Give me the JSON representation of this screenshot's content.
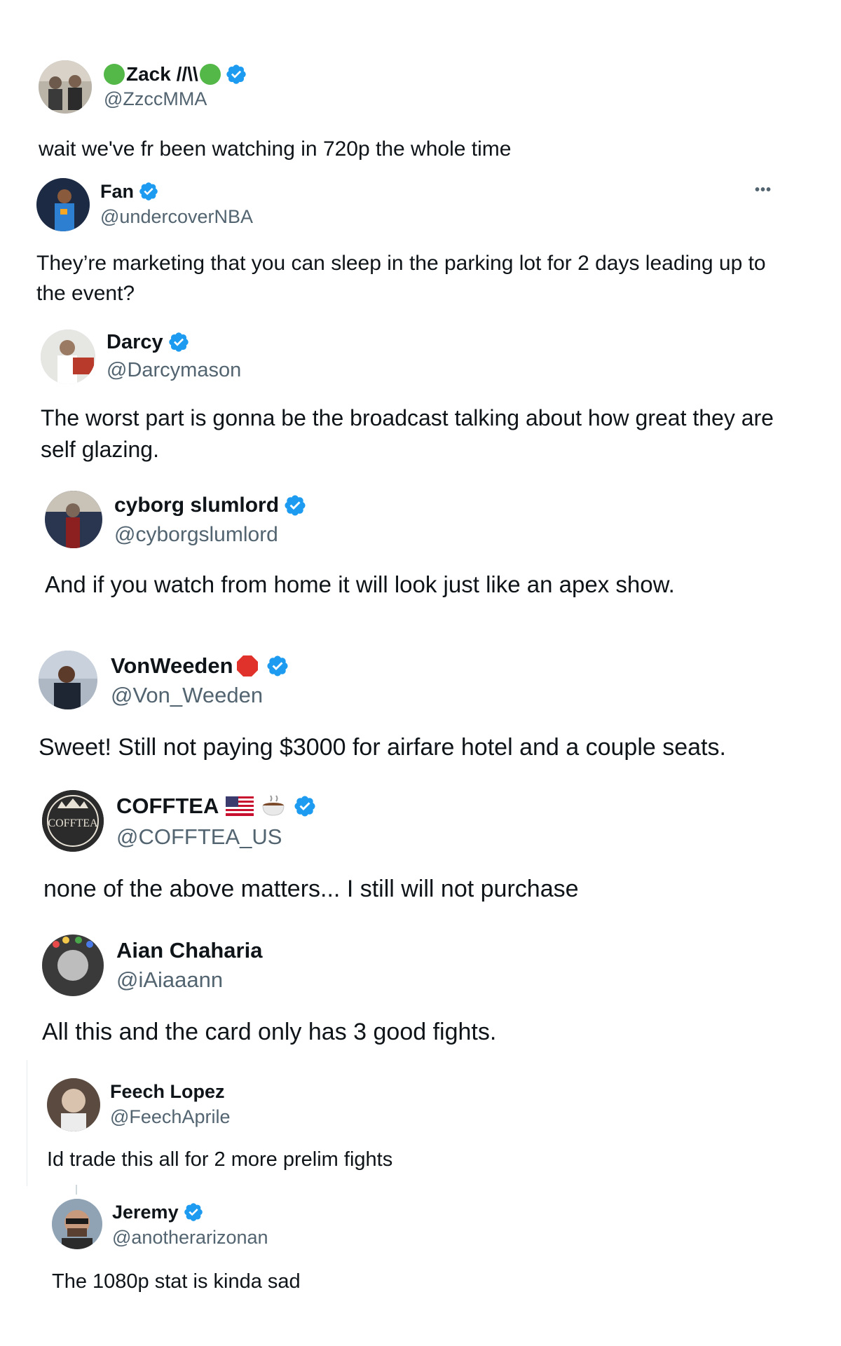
{
  "posts": [
    {
      "name": "Zack //\\\\",
      "handle": "@ZzccMMA",
      "text": "wait we've fr been watching in 720p the whole time",
      "verified": true
    },
    {
      "name": "Fan",
      "handle": "@undercoverNBA",
      "text": "They’re marketing that you can sleep in the parking lot for 2 days leading up to the event?",
      "verified": true,
      "more": "•••"
    },
    {
      "name": "Darcy",
      "handle": "@Darcymason",
      "text": "The worst part is gonna be the broadcast talking about how great they are self glazing.",
      "verified": true
    },
    {
      "name": "cyborg slumlord",
      "handle": "@cyborgslumlord",
      "text": "And if you watch from home it will look just like an apex show.",
      "verified": true
    },
    {
      "name": "VonWeeden",
      "handle": "@Von_Weeden",
      "text": "Sweet! Still not paying $3000 for airfare hotel and a couple seats.",
      "verified": true
    },
    {
      "name": "COFFTEA",
      "handle": "@COFFTEA_US",
      "text": "none of the above matters... I still will not purchase",
      "verified": true,
      "avatar_text": "COFFTEA"
    },
    {
      "name": "Aian Chaharia",
      "handle": "@iAiaaann",
      "text": "All this and the card only has 3 good fights.",
      "verified": false
    },
    {
      "name": "Feech Lopez",
      "handle": "@FeechAprile",
      "text": "Id trade this all for 2 more prelim fights",
      "verified": false
    },
    {
      "name": "Jeremy",
      "handle": "@anotherarizonan",
      "text": "The 1080p stat is kinda sad",
      "verified": true
    }
  ],
  "colors": {
    "verified": "#1d9bf0",
    "handle": "#536471",
    "text": "#0f1419",
    "green_circle": "#53b848",
    "stop_sign": "#e0322b"
  },
  "icons": [
    "verified-badge-icon",
    "green-circle-emoji",
    "stop-sign-emoji",
    "us-flag-emoji",
    "hot-beverage-emoji",
    "more-options-icon"
  ]
}
